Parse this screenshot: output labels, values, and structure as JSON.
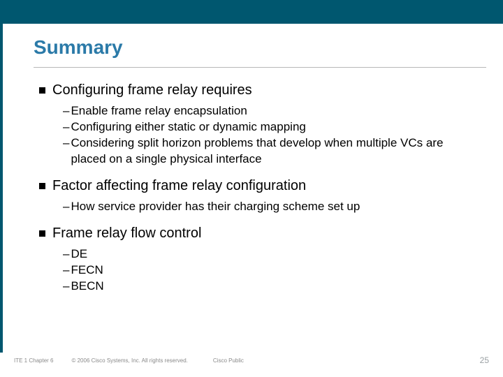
{
  "colors": {
    "brand_bar": "#00576f",
    "title": "#2b7aa8"
  },
  "title": "Summary",
  "sections": [
    {
      "heading": "Configuring frame relay requires",
      "subs": [
        "Enable frame relay encapsulation",
        "Configuring either static or dynamic mapping",
        "Considering split horizon problems that develop when multiple VCs are placed on a single physical interface"
      ]
    },
    {
      "heading": "Factor affecting frame relay configuration",
      "subs": [
        "How service provider has their charging scheme set up"
      ]
    },
    {
      "heading": "Frame relay flow control",
      "subs": [
        "DE",
        "FECN",
        "BECN"
      ]
    }
  ],
  "footer": {
    "left": "ITE 1 Chapter 6",
    "copyright": "© 2006 Cisco Systems, Inc. All rights reserved.",
    "public": "Cisco Public",
    "page": "25"
  }
}
